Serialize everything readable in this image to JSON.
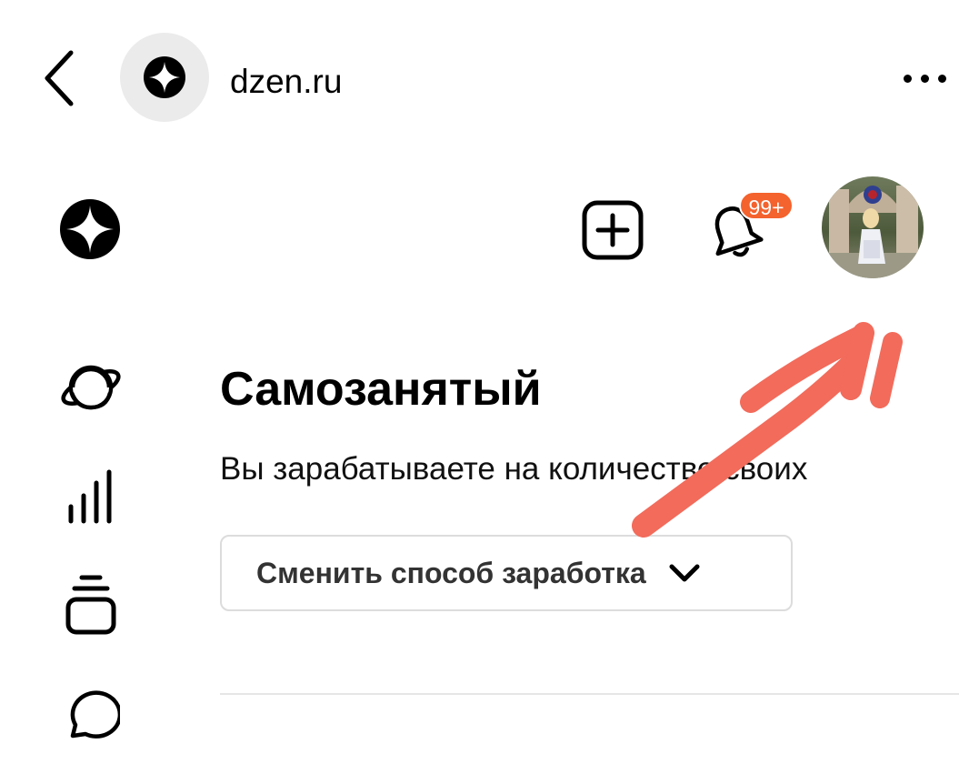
{
  "browser": {
    "domain": "dzen.ru",
    "back_icon": "chevron-left-icon",
    "more_icon": "more-horizontal-icon"
  },
  "header": {
    "logo_icon": "dzen-logo-icon",
    "add_icon": "plus-square-icon",
    "notifications_icon": "bell-icon",
    "notifications_count": "99+",
    "avatar_icon": "user-avatar"
  },
  "nav": {
    "items": [
      {
        "icon": "planet-icon"
      },
      {
        "icon": "stats-bars-icon"
      },
      {
        "icon": "stack-icon"
      },
      {
        "icon": "chat-bubble-icon"
      }
    ]
  },
  "main": {
    "title": "Самозанятый",
    "description": "Вы зарабатываете на количестве своих",
    "change_method_label": "Сменить способ заработка"
  },
  "colors": {
    "badge": "#f4622d",
    "annotation_arrow": "#f26b5b",
    "site_icon_bg": "#ebebeb"
  }
}
